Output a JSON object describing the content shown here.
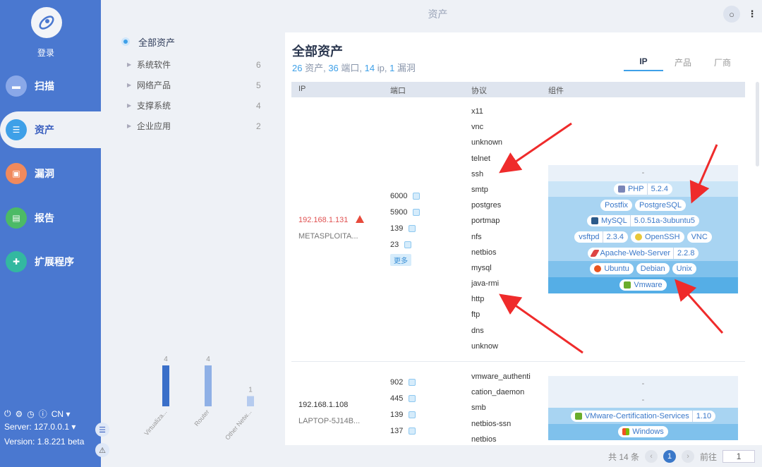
{
  "sidebar": {
    "login": "登录",
    "nav": [
      {
        "label": "扫描",
        "icon": "scan-icon",
        "color": "#8aa8e8"
      },
      {
        "label": "资产",
        "icon": "asset-icon",
        "color": "#3ea0e8"
      },
      {
        "label": "漏洞",
        "icon": "vuln-icon",
        "color": "#f08a5d"
      },
      {
        "label": "报告",
        "icon": "report-icon",
        "color": "#4cba66"
      },
      {
        "label": "扩展程序",
        "icon": "plugin-icon",
        "color": "#33b8a0"
      }
    ],
    "lang": "CN",
    "server": "Server: 127.0.0.1",
    "version": "Version: 1.8.221 beta"
  },
  "header": {
    "title": "资产"
  },
  "tree": {
    "root": "全部资产",
    "items": [
      {
        "name": "系统软件",
        "count": "6"
      },
      {
        "name": "网络产品",
        "count": "5"
      },
      {
        "name": "支撑系统",
        "count": "4"
      },
      {
        "name": "企业应用",
        "count": "2"
      }
    ]
  },
  "chart_data": {
    "type": "bar",
    "categories": [
      "Virtualiza...",
      "Router",
      "Other Netw..."
    ],
    "values": [
      4,
      4,
      1
    ],
    "ylim": [
      0,
      4
    ],
    "grid": false,
    "colors": [
      "#3a6fc9",
      "#8fb0e6",
      "#b5cbef"
    ]
  },
  "panel": {
    "title": "全部资产",
    "summary": {
      "assets_num": "26",
      "assets_label": " 资产, ",
      "ports_num": "36",
      "ports_label": " 端口, ",
      "ip_num": "14",
      "ip_label": " ip, ",
      "vuln_num": "1",
      "vuln_label": " 漏洞"
    },
    "tabs": [
      "IP",
      "产品",
      "厂商"
    ],
    "columns": [
      "IP",
      "端口",
      "协议",
      "组件"
    ],
    "rows": [
      {
        "ip": "192.168.1.131",
        "host": "METASPLOITA...",
        "ports": [
          "6000",
          "5900",
          "139",
          "23"
        ],
        "more": "更多",
        "protocols": [
          "x11",
          "vnc",
          "unknown",
          "telnet",
          "ssh",
          "smtp",
          "postgres",
          "portmap",
          "nfs",
          "netbios",
          "mysql",
          "java-rmi",
          "http",
          "ftp",
          "dns",
          "unknow"
        ],
        "components": {
          "empty": "-",
          "php": "PHP",
          "php_ver": "5.2.4",
          "postfix": "Postfix",
          "postgresql": "PostgreSQL",
          "mysql": "MySQL",
          "mysql_ver": "5.0.51a-3ubuntu5",
          "vsftpd": "vsftpd",
          "vsftpd_ver": "2.3.4",
          "openssh": "OpenSSH",
          "vnc": "VNC",
          "apache": "Apache-Web-Server",
          "apache_ver": "2.2.8",
          "ubuntu": "Ubuntu",
          "debian": "Debian",
          "unix": "Unix",
          "vmware": "Vmware"
        }
      },
      {
        "ip": "192.168.1.108",
        "host": "LAPTOP-5J14B...",
        "ports": [
          "902",
          "445",
          "139",
          "137"
        ],
        "protocols": [
          "vmware_authenti",
          "cation_daemon",
          "smb",
          "netbios-ssn",
          "netbios"
        ],
        "components": {
          "empty1": "-",
          "empty2": "-",
          "vmcert": "VMware-Certification-Services",
          "vmcert_ver": "1.10",
          "windows": "Windows"
        }
      }
    ]
  },
  "pagination": {
    "total": "共 14 条",
    "current": "1",
    "goto": "前往",
    "input": "1"
  },
  "colors": {
    "accent": "#3ea0e8",
    "sidebar": "#4a78d0",
    "danger": "#e74a3b"
  }
}
